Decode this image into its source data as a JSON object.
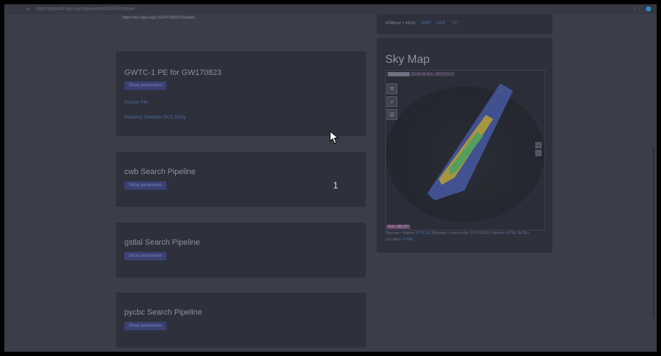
{
  "browser": {
    "nav_icons": "← → ⟳",
    "url": "https://gracedb.ligo.org/superevents/S190521r/view/",
    "toolbar_icons": "☆ ⋮"
  },
  "top_url": "https://dcc.ligo.org/LIGO-P1800370/public",
  "right_top": {
    "text": "4096sec • 4KHz",
    "links": [
      "GWF",
      "HDF",
      "TXT"
    ]
  },
  "cards": [
    {
      "title": "GWTC-1 PE for GW170823",
      "button": "Show parameters",
      "links": [
        "Source File",
        "Posterior Samples DCC Entry"
      ]
    },
    {
      "title": "cwb Search Pipeline",
      "button": "Show parameters",
      "links": []
    },
    {
      "title": "gstlal Search Pipeline",
      "button": "Show parameters",
      "links": []
    },
    {
      "title": "pycbc Search Pipeline",
      "button": "Show parameters",
      "links": []
    }
  ],
  "sky_map": {
    "title": "Sky Map",
    "coord_readout": "03:45:55.432, -08°23'11.8\"",
    "fov": "FoV: 180.00°",
    "zoom_in": "+",
    "zoom_out": "−",
    "caption_parts": [
      "Skymap • flatten: ",
      "FITS.GZ",
      " Skymap • multi-order: ",
      "FITS",
      " GCN • Notice: ",
      "HTML",
      " GCN • Circulars: ",
      "HTML"
    ]
  },
  "overlay_number": "1",
  "colors": {
    "background": "#3b3d49",
    "card": "#2e303b",
    "button": "#3a4072",
    "link": "#4d6ea0"
  }
}
